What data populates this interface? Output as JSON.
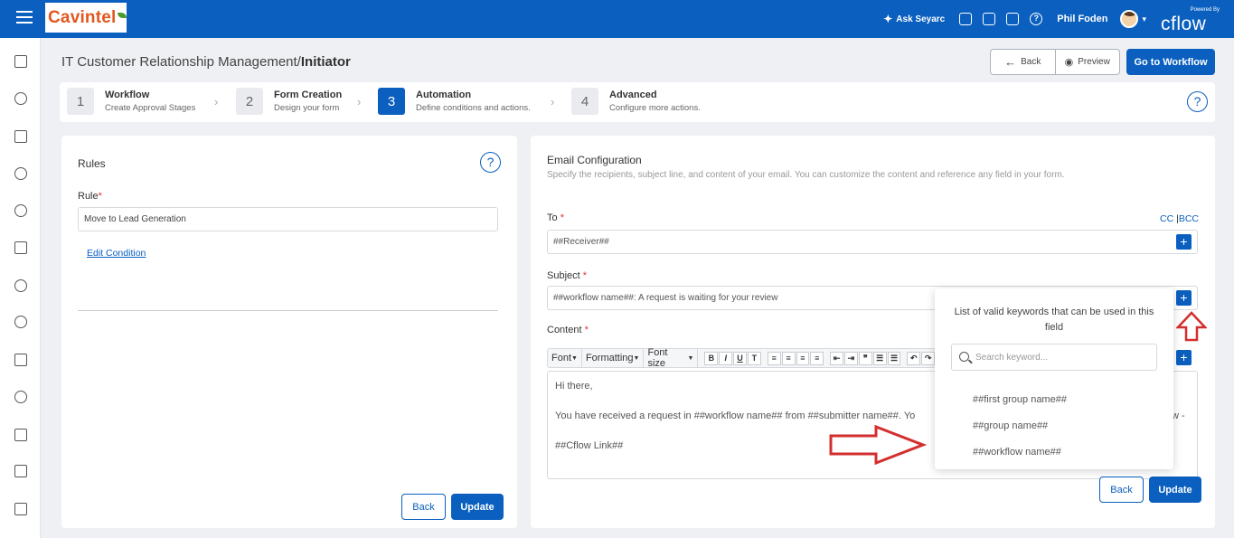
{
  "topbar": {
    "logo_text": "Cavintel",
    "ask_label": "Ask Seyarc",
    "user_name": "Phil Foden",
    "brand_powered": "Powered By",
    "brand_name": "cflow"
  },
  "page": {
    "title_prefix": "IT Customer Relationship Management/",
    "title_strong": "Initiator",
    "back_label": "Back",
    "preview_label": "Preview",
    "goto_label": "Go to Workflow"
  },
  "stepper": {
    "steps": [
      {
        "num": "1",
        "title": "Workflow",
        "sub": "Create Approval Stages"
      },
      {
        "num": "2",
        "title": "Form Creation",
        "sub": "Design your form"
      },
      {
        "num": "3",
        "title": "Automation",
        "sub": "Define conditions and actions."
      },
      {
        "num": "4",
        "title": "Advanced",
        "sub": "Configure more actions."
      }
    ],
    "active": 3
  },
  "rules": {
    "title": "Rules",
    "rule_label": "Rule",
    "rule_value": "Move to Lead Generation",
    "edit_condition": "Edit Condition",
    "back_label": "Back",
    "update_label": "Update"
  },
  "email": {
    "title": "Email Configuration",
    "description": "Specify the recipients, subject line, and content of your email. You can customize the content and reference any field in your form.",
    "to_label": "To",
    "cc_label": "CC",
    "bcc_label": "BCC",
    "to_value": "##Receiver##",
    "subject_label": "Subject",
    "subject_value": "##workflow name##: A request is waiting for your review",
    "content_label": "Content",
    "toolbar": {
      "font": "Font",
      "formatting": "Formatting",
      "font_size": "Font size"
    },
    "content_lines": [
      "Hi there,",
      "You have received a request in ##workflow name## from ##submitter name##. Yo",
      "##Cflow Link##"
    ],
    "content_trail": "w -",
    "back_label": "Back",
    "update_label": "Update"
  },
  "keyword_popover": {
    "title": "List of valid keywords that can be used in this field",
    "search_placeholder": "Search keyword...",
    "keywords": [
      "##first group name##",
      "##group name##",
      "##workflow name##"
    ]
  },
  "colors": {
    "brand_blue": "#0a5fbf",
    "annotation_red": "#d32f2f",
    "logo_orange": "#e2571f"
  }
}
